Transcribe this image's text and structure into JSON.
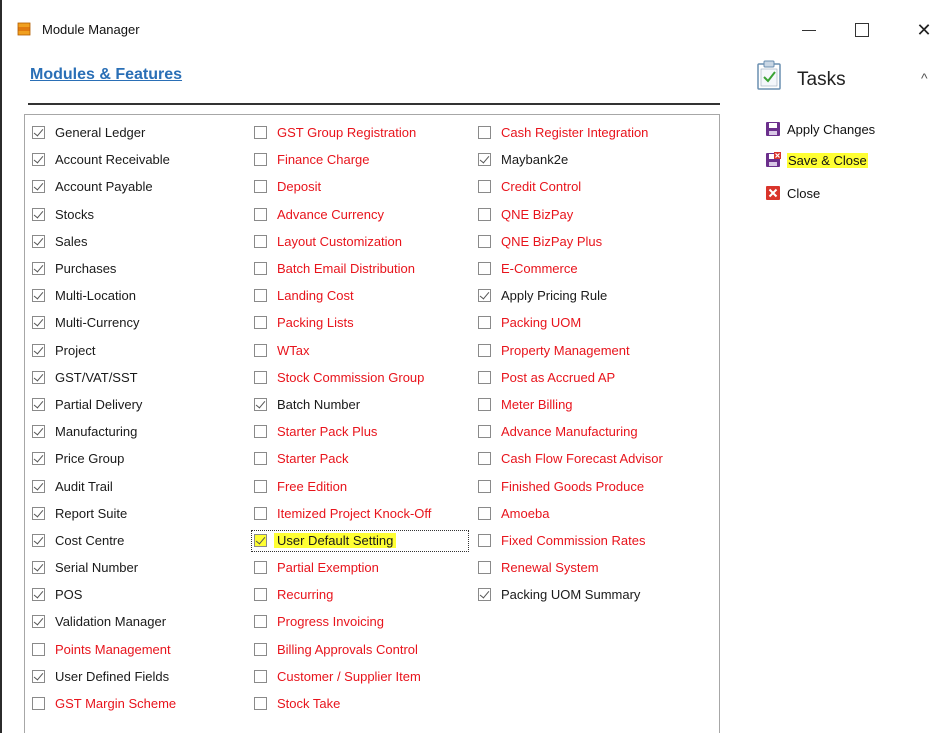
{
  "window": {
    "title": "Module Manager",
    "controls": {
      "minimize": "—",
      "maximize": "☐",
      "close": "✕"
    }
  },
  "section": {
    "title": "Modules & Features"
  },
  "columns": [
    [
      {
        "label": "General Ledger",
        "checked": true,
        "color": "black"
      },
      {
        "label": "Account Receivable",
        "checked": true,
        "color": "black"
      },
      {
        "label": "Account Payable",
        "checked": true,
        "color": "black"
      },
      {
        "label": "Stocks",
        "checked": true,
        "color": "black"
      },
      {
        "label": "Sales",
        "checked": true,
        "color": "black"
      },
      {
        "label": "Purchases",
        "checked": true,
        "color": "black"
      },
      {
        "label": "Multi-Location",
        "checked": true,
        "color": "black"
      },
      {
        "label": "Multi-Currency",
        "checked": true,
        "color": "black"
      },
      {
        "label": "Project",
        "checked": true,
        "color": "black"
      },
      {
        "label": "GST/VAT/SST",
        "checked": true,
        "color": "black"
      },
      {
        "label": "Partial Delivery",
        "checked": true,
        "color": "black"
      },
      {
        "label": "Manufacturing",
        "checked": true,
        "color": "black"
      },
      {
        "label": "Price Group",
        "checked": true,
        "color": "black"
      },
      {
        "label": "Audit Trail",
        "checked": true,
        "color": "black"
      },
      {
        "label": "Report Suite",
        "checked": true,
        "color": "black"
      },
      {
        "label": "Cost Centre",
        "checked": true,
        "color": "black"
      },
      {
        "label": "Serial Number",
        "checked": true,
        "color": "black"
      },
      {
        "label": "POS",
        "checked": true,
        "color": "black"
      },
      {
        "label": "Validation Manager",
        "checked": true,
        "color": "black"
      },
      {
        "label": "Points Management",
        "checked": false,
        "color": "red"
      },
      {
        "label": "User Defined Fields",
        "checked": true,
        "color": "black"
      },
      {
        "label": "GST Margin Scheme",
        "checked": false,
        "color": "red"
      }
    ],
    [
      {
        "label": "GST Group Registration",
        "checked": false,
        "color": "red"
      },
      {
        "label": "Finance Charge",
        "checked": false,
        "color": "red"
      },
      {
        "label": "Deposit",
        "checked": false,
        "color": "red"
      },
      {
        "label": "Advance Currency",
        "checked": false,
        "color": "red"
      },
      {
        "label": "Layout Customization",
        "checked": false,
        "color": "red"
      },
      {
        "label": "Batch Email Distribution",
        "checked": false,
        "color": "red"
      },
      {
        "label": "Landing Cost",
        "checked": false,
        "color": "red"
      },
      {
        "label": "Packing Lists",
        "checked": false,
        "color": "red"
      },
      {
        "label": "WTax",
        "checked": false,
        "color": "red"
      },
      {
        "label": "Stock Commission Group",
        "checked": false,
        "color": "red"
      },
      {
        "label": "Batch Number",
        "checked": true,
        "color": "black"
      },
      {
        "label": "Starter Pack Plus",
        "checked": false,
        "color": "red"
      },
      {
        "label": "Starter Pack",
        "checked": false,
        "color": "red"
      },
      {
        "label": "Free Edition",
        "checked": false,
        "color": "red"
      },
      {
        "label": "Itemized Project Knock-Off",
        "checked": false,
        "color": "red"
      },
      {
        "label": "User Default Setting",
        "checked": true,
        "color": "black",
        "highlight": true
      },
      {
        "label": "Partial Exemption",
        "checked": false,
        "color": "red"
      },
      {
        "label": "Recurring",
        "checked": false,
        "color": "red"
      },
      {
        "label": "Progress Invoicing",
        "checked": false,
        "color": "red"
      },
      {
        "label": "Billing Approvals Control",
        "checked": false,
        "color": "red"
      },
      {
        "label": "Customer / Supplier Item",
        "checked": false,
        "color": "red"
      },
      {
        "label": "Stock Take",
        "checked": false,
        "color": "red"
      }
    ],
    [
      {
        "label": "Cash Register Integration",
        "checked": false,
        "color": "red"
      },
      {
        "label": "Maybank2e",
        "checked": true,
        "color": "black"
      },
      {
        "label": "Credit Control",
        "checked": false,
        "color": "red"
      },
      {
        "label": "QNE BizPay",
        "checked": false,
        "color": "red"
      },
      {
        "label": "QNE BizPay Plus",
        "checked": false,
        "color": "red"
      },
      {
        "label": "E-Commerce",
        "checked": false,
        "color": "red"
      },
      {
        "label": "Apply Pricing Rule",
        "checked": true,
        "color": "black"
      },
      {
        "label": "Packing UOM",
        "checked": false,
        "color": "red"
      },
      {
        "label": "Property Management",
        "checked": false,
        "color": "red"
      },
      {
        "label": "Post as Accrued AP",
        "checked": false,
        "color": "red"
      },
      {
        "label": "Meter Billing",
        "checked": false,
        "color": "red"
      },
      {
        "label": "Advance Manufacturing",
        "checked": false,
        "color": "red"
      },
      {
        "label": "Cash Flow Forecast Advisor",
        "checked": false,
        "color": "red"
      },
      {
        "label": "Finished Goods Produce",
        "checked": false,
        "color": "red"
      },
      {
        "label": "Amoeba",
        "checked": false,
        "color": "red"
      },
      {
        "label": "Fixed Commission Rates",
        "checked": false,
        "color": "red"
      },
      {
        "label": "Renewal System",
        "checked": false,
        "color": "red"
      },
      {
        "label": "Packing UOM Summary",
        "checked": true,
        "color": "black"
      }
    ]
  ],
  "tasks": {
    "title": "Tasks",
    "collapse_glyph": "^",
    "items": [
      {
        "label": "Apply Changes",
        "icon": "save-icon"
      },
      {
        "label": "Save & Close",
        "icon": "save-close-icon",
        "highlight": true
      },
      {
        "label": "Close",
        "icon": "close-icon"
      }
    ]
  },
  "colors": {
    "link_blue": "#2a6fb6",
    "disabled_red": "#e8141c",
    "highlight_yellow": "#ffff33",
    "save_icon_purple": "#6b2f8c",
    "close_icon_red": "#d9342b"
  }
}
